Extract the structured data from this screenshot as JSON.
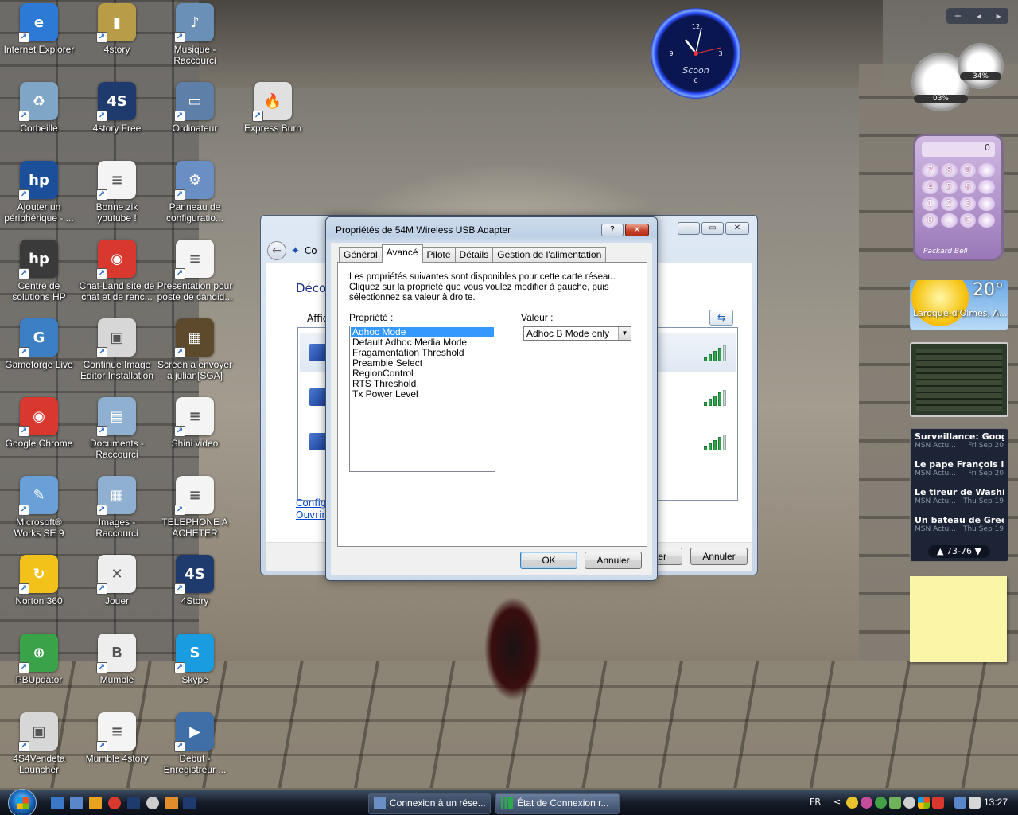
{
  "desktop_icons": [
    {
      "label": "Internet Explorer",
      "icon": "internet-explorer-icon",
      "color": "#2d79d6",
      "glyph": "e"
    },
    {
      "label": "4story",
      "icon": "folder-icon",
      "color": "#b89c48",
      "glyph": "▮"
    },
    {
      "label": "Musique -\nRaccourci",
      "icon": "music-folder-icon",
      "color": "#6b90b8",
      "glyph": "♪"
    },
    {
      "label": "Corbeille",
      "icon": "recycle-bin-icon",
      "color": "#7fa6c7",
      "glyph": "♻"
    },
    {
      "label": "4story Free",
      "icon": "4story-game-icon",
      "color": "#1f3a6d",
      "glyph": "4S"
    },
    {
      "label": "Ordinateur",
      "icon": "computer-icon",
      "color": "#5e7fa8",
      "glyph": "▭"
    },
    {
      "label": "Express Burn",
      "icon": "express-burn-icon",
      "color": "#e0e0e0",
      "glyph": "🔥"
    },
    {
      "label": "Ajouter un\npériphérique - ...",
      "icon": "hp-add-device-icon",
      "color": "#1b4f9a",
      "glyph": "hp"
    },
    {
      "label": "Bonne zik\nyoutube !",
      "icon": "text-document-icon",
      "color": "#f4f4f4",
      "glyph": "≡"
    },
    {
      "label": "Panneau de\nconfiguratio...",
      "icon": "control-panel-icon",
      "color": "#6a8fc4",
      "glyph": "⚙"
    },
    {
      "label": "Centre de\nsolutions HP",
      "icon": "hp-solution-center-icon",
      "color": "#3a3a3a",
      "glyph": "hp"
    },
    {
      "label": "Chat-Land site de\nchat et de renc...",
      "icon": "chrome-shortcut-icon",
      "color": "#d8382e",
      "glyph": "◉"
    },
    {
      "label": "Presentation pour\nposte de candid...",
      "icon": "text-document-icon",
      "color": "#f4f4f4",
      "glyph": "≡"
    },
    {
      "label": "Gameforge Live",
      "icon": "gameforge-live-icon",
      "color": "#3d7fc4",
      "glyph": "G"
    },
    {
      "label": "Continue Image\nEditor Installation",
      "icon": "installer-icon",
      "color": "#d7d7d7",
      "glyph": "▣"
    },
    {
      "label": "Screen a envoyer\na julian[SGA]",
      "icon": "image-file-icon",
      "color": "#5d4a2c",
      "glyph": "▦"
    },
    {
      "label": "Google Chrome",
      "icon": "google-chrome-icon",
      "color": "#d8382e",
      "glyph": "◉"
    },
    {
      "label": "Documents -\nRaccourci",
      "icon": "documents-folder-icon",
      "color": "#8fb0d0",
      "glyph": "▤"
    },
    {
      "label": "Shini video",
      "icon": "text-document-icon",
      "color": "#f4f4f4",
      "glyph": "≡"
    },
    {
      "label": "Microsoft®\nWorks SE 9",
      "icon": "microsoft-works-icon",
      "color": "#6aa0d8",
      "glyph": "✎"
    },
    {
      "label": "Images -\nRaccourci",
      "icon": "pictures-folder-icon",
      "color": "#8fb0d0",
      "glyph": "▦"
    },
    {
      "label": "TELEPHONE A\nACHETER",
      "icon": "text-document-icon",
      "color": "#f4f4f4",
      "glyph": "≡"
    },
    {
      "label": "Norton 360",
      "icon": "norton-360-icon",
      "color": "#f2c21a",
      "glyph": "↻"
    },
    {
      "label": "Jouer",
      "icon": "hitman-game-icon",
      "color": "#eeeeee",
      "glyph": "✕"
    },
    {
      "label": "4Story",
      "icon": "4story-game-icon",
      "color": "#1f3a6d",
      "glyph": "4S"
    },
    {
      "label": "PBUpdator",
      "icon": "pb-updator-icon",
      "color": "#3aa34a",
      "glyph": "⊕"
    },
    {
      "label": "Mumble",
      "icon": "mumble-icon",
      "color": "#eeeeee",
      "glyph": "B"
    },
    {
      "label": "Skype",
      "icon": "skype-icon",
      "color": "#1a9de0",
      "glyph": "S"
    },
    {
      "label": "4S4Vendeta\nLauncher",
      "icon": "launcher-icon",
      "color": "#d7d7d7",
      "glyph": "▣"
    },
    {
      "label": "Mumble 4story",
      "icon": "text-document-icon",
      "color": "#f4f4f4",
      "glyph": "≡"
    },
    {
      "label": "Debut -\nEnregistreur ...",
      "icon": "debut-recorder-icon",
      "color": "#3f6fa6",
      "glyph": "▶"
    }
  ],
  "gadgets": {
    "clock_brand": "Scoon",
    "cpu_meter": {
      "cpu": "03%",
      "memory": "34%"
    },
    "calculator": {
      "display": "0",
      "keys": [
        "7",
        "8",
        "9",
        "",
        "4",
        "5",
        "6",
        "",
        "1",
        "2",
        "3",
        "",
        "0",
        ".",
        "C",
        ""
      ],
      "brand": "Packard Bell"
    },
    "weather": {
      "temperature": "20°",
      "city": "Laroque-d'Olmes, A..."
    },
    "news": {
      "items": [
        {
          "headline": "Surveillance: Google,...",
          "source": "MSN Actu...",
          "date": "Fri Sep 20"
        },
        {
          "headline": "Le pape François livr...",
          "source": "MSN Actu...",
          "date": "Fri Sep 20"
        },
        {
          "headline": "Le tireur de Washing...",
          "source": "MSN Actu...",
          "date": "Thu Sep 19"
        },
        {
          "headline": "Un bateau de Green...",
          "source": "MSN Actu...",
          "date": "Thu Sep 19"
        }
      ],
      "pager": "73-76"
    }
  },
  "back_window": {
    "title": "Co",
    "heading": "Déco",
    "show_label": "Affic",
    "links": [
      "Config",
      "Ouvrir"
    ],
    "connect_label": "ter",
    "cancel_label": "Annuler"
  },
  "dialog": {
    "title": "Propriétés de 54M Wireless USB Adapter",
    "help_label": "?",
    "close_label": "✕",
    "tabs": [
      "Général",
      "Avancé",
      "Pilote",
      "Détails",
      "Gestion de l'alimentation"
    ],
    "active_tab": 1,
    "description": "Les propriétés suivantes sont disponibles pour cette carte réseau. Cliquez sur la propriété que vous voulez modifier à gauche, puis sélectionnez sa valeur à droite.",
    "property_label": "Propriété :",
    "value_label": "Valeur :",
    "properties": [
      "Adhoc Mode",
      "Default Adhoc Media Mode",
      "Fragamentation Threshold",
      "Preamble Select",
      "RegionControl",
      "RTS Threshold",
      "Tx Power Level"
    ],
    "selected_property": 0,
    "value": "Adhoc B Mode only",
    "ok_label": "OK",
    "cancel_label": "Annuler"
  },
  "taskbar": {
    "tasks": [
      "Connexion à un rése...",
      "État de Connexion r..."
    ],
    "language": "FR",
    "tray_arrow": "<",
    "time": "13:27"
  }
}
